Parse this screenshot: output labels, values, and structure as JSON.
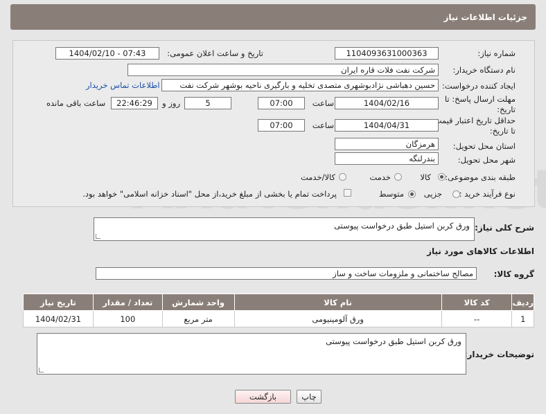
{
  "header": {
    "title": "جزئیات اطلاعات نیاز"
  },
  "watermark": "AriaTender.net",
  "form": {
    "need_number_label": "شماره نیاز:",
    "need_number": "1104093631000363",
    "announce_label": "تاریخ و ساعت اعلان عمومی:",
    "announce_value": "1404/02/10 - 07:43",
    "buyer_label": "نام دستگاه خریدار:",
    "buyer_value": "شرکت نفت فلات قاره ایران",
    "creator_label": "ایجاد کننده درخواست:",
    "creator_value": "حسین دهباشی نژادبوشهری متصدی تخلیه و بارگیری ناحیه بوشهر شرکت نفت",
    "contact_link": "اطلاعات تماس خریدار",
    "deadline_label_1": "مهلت ارسال پاسخ: تا",
    "deadline_label_2": "تاریخ:",
    "deadline_date": "1404/02/16",
    "time_label": "ساعت",
    "deadline_time": "07:00",
    "days_value": "5",
    "days_label": "روز و",
    "remaining_value": "22:46:29",
    "remaining_label": "ساعت باقی مانده",
    "validity_label_1": "حداقل تاریخ اعتبار قیمت:",
    "validity_label_2": "تا تاریخ:",
    "validity_date": "1404/04/31",
    "validity_time": "07:00",
    "province_label": "استان محل تحویل:",
    "province_value": "هرمزگان",
    "city_label": "شهر محل تحویل:",
    "city_value": "بندرلنگه",
    "category_label": "طبقه بندی موضوعی:",
    "category_options": [
      "کالا",
      "خدمت",
      "کالا/خدمت"
    ],
    "category_selected": "کالا",
    "process_label": "نوع فرآیند خرید :",
    "process_options": [
      "جزیی",
      "متوسط"
    ],
    "process_selected": "متوسط",
    "payment_note": "پرداخت تمام یا بخشی از مبلغ خرید،از محل \"اسناد خزانه اسلامی\" خواهد بود."
  },
  "description": {
    "label": "شرح کلی نیاز:",
    "value": "ورق کربن استیل طبق درخواست پیوستی"
  },
  "goods_section": {
    "title": "اطلاعات کالاهای مورد نیاز",
    "group_label": "گروه کالا:",
    "group_value": "مصالح ساختمانی و ملزومات ساخت و ساز"
  },
  "table": {
    "columns": [
      "ردیف",
      "کد کالا",
      "نام کالا",
      "واحد شمارش",
      "تعداد / مقدار",
      "تاریخ نیاز"
    ],
    "rows": [
      [
        "1",
        "--",
        "ورق آلومینیومی",
        "متر مربع",
        "100",
        "1404/02/31"
      ]
    ]
  },
  "buyer_notes": {
    "label": "توضیحات خریدار:",
    "value": "ورق کربن استیل طبق درخواست پیوستی"
  },
  "buttons": {
    "print": "چاپ",
    "back": "بازگشت"
  }
}
